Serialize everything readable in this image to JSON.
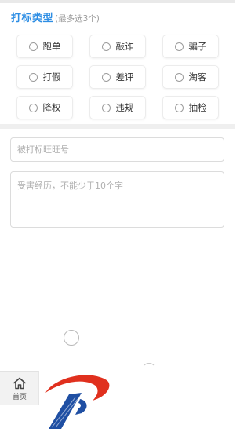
{
  "report_type": {
    "title": "打标类型",
    "hint": "(最多选3个)",
    "options": [
      {
        "label": "跑单"
      },
      {
        "label": "敲诈"
      },
      {
        "label": "骗子"
      },
      {
        "label": "打假"
      },
      {
        "label": "差评"
      },
      {
        "label": "淘客"
      },
      {
        "label": "降权"
      },
      {
        "label": "违规"
      },
      {
        "label": "抽检"
      }
    ]
  },
  "form": {
    "account_placeholder": "被打标旺旺号",
    "account_value": "",
    "experience_placeholder": "受害经历，不能少于10个字",
    "experience_value": ""
  },
  "tabbar": {
    "home_label": "首页",
    "home_icon": "home-icon"
  },
  "colors": {
    "accent": "#2e8ee4",
    "watermark_red": "#e0301e",
    "watermark_blue": "#1f4fa3"
  }
}
